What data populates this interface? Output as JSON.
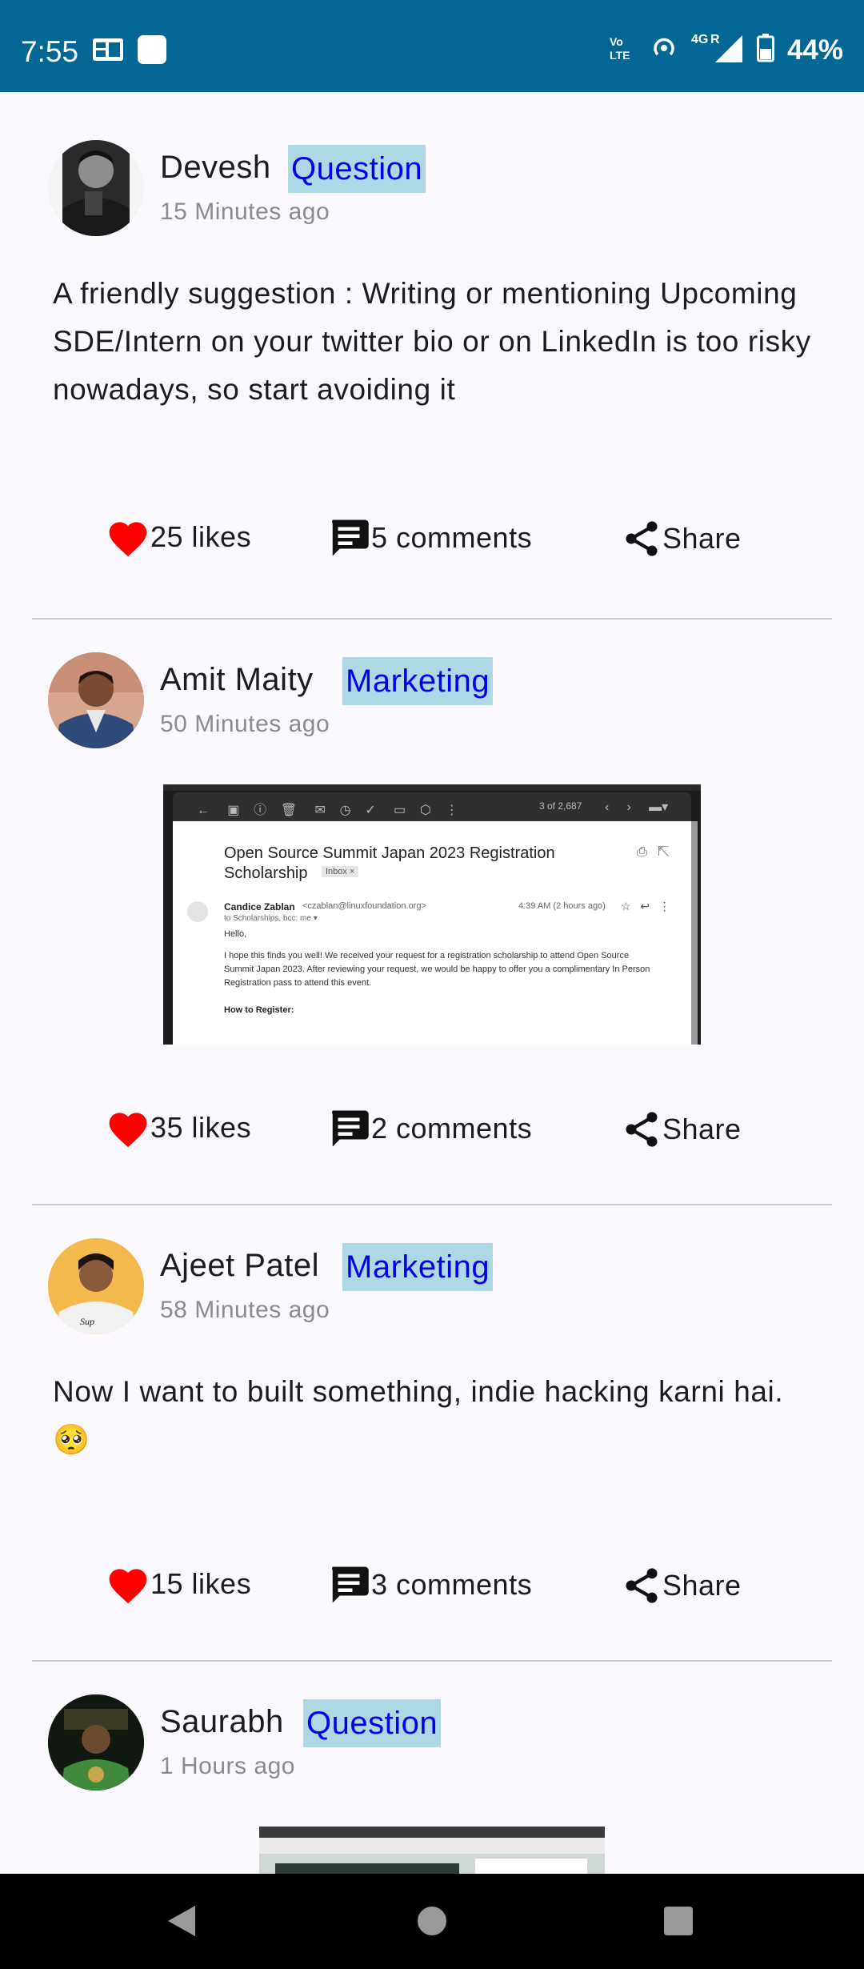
{
  "status_bar": {
    "time": "7:55",
    "network": "4G",
    "battery": "44%"
  },
  "posts": [
    {
      "author": "Devesh",
      "tag": "Question",
      "time": "15 Minutes ago",
      "text": "A friendly suggestion : Writing or mentioning Upcoming SDE/Intern on your twitter bio or on LinkedIn is too risky nowadays, so start avoiding it",
      "likes": "25 likes",
      "comments": "5 comments",
      "share": "Share"
    },
    {
      "author": "Amit Maity",
      "tag": "Marketing",
      "time": "50 Minutes ago",
      "image": {
        "toolbar_count": "3 of 2,687",
        "subject": "Open Source Summit Japan 2023 Registration Scholarship",
        "label": "Inbox ×",
        "sender": "Candice Zablan",
        "sender_email": "<czablan@linuxfoundation.org>",
        "sent_time": "4:39 AM (2 hours ago)",
        "to": "to Scholarships, bcc: me ▾",
        "greeting": "Hello,",
        "body": "I hope this finds you well! We received your request for a registration scholarship to attend Open Source Summit Japan 2023. After reviewing your request, we would be happy to offer you a complimentary In Person Registration pass to attend this event.",
        "heading": "How to Register:"
      },
      "likes": "35 likes",
      "comments": "2 comments",
      "share": "Share"
    },
    {
      "author": "Ajeet Patel",
      "tag": "Marketing",
      "time": "58 Minutes ago",
      "text": "Now I want to built something, indie hacking karni hai. 🥺",
      "likes": "15 likes",
      "comments": "3 comments",
      "share": "Share"
    },
    {
      "author": "Saurabh",
      "tag": "Question",
      "time": "1 Hours ago"
    }
  ],
  "colors": {
    "status_bar": "#036796",
    "tag_bg": "#add8e6",
    "tag_text": "#0000ee",
    "like_heart": "#ff0000",
    "divider": "#c9c7d3"
  },
  "icons": [
    "like-heart-icon",
    "comment-icon",
    "share-icon",
    "back-icon",
    "home-icon",
    "recents-icon"
  ]
}
